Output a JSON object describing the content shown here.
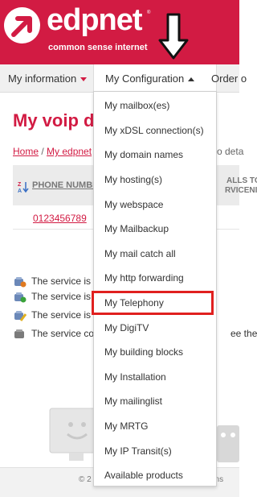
{
  "brand": {
    "name": "edpnet",
    "trademark": "®",
    "tagline": "common sense internet",
    "brand_color": "#d21b43"
  },
  "nav": {
    "my_information": "My information",
    "my_configuration": "My Configuration",
    "order": "Order o"
  },
  "dropdown": {
    "items": [
      "My mailbox(es)",
      "My xDSL connection(s)",
      "My domain names",
      "My hosting(s)",
      "My webspace",
      "My Mailbackup",
      "My mail catch all",
      "My http forwarding",
      "My Telephony",
      "My DigiTV",
      "My building blocks",
      "My Installation",
      "My mailinglist",
      "My MRTG",
      "My IP Transit(s)",
      "Available products"
    ],
    "highlighted_item": "My Telephony",
    "highlight_color": "#e0201f"
  },
  "page": {
    "title": "My voip d",
    "breadcrumb_home": "Home",
    "breadcrumb_sep": " / ",
    "breadcrumb_second": "My edpnet",
    "breadcrumb_tail": "o deta"
  },
  "table": {
    "header_phone": "PHONE NUMBE",
    "header_calls_line1": "ALLS TO",
    "header_calls_line2": "RVICENI",
    "rows": [
      {
        "phone": "0123456789"
      }
    ]
  },
  "legend": [
    {
      "text": "The service is",
      "tail": ""
    },
    {
      "text": "The service is",
      "tail": ""
    },
    {
      "text": "The service is",
      "tail": ""
    },
    {
      "text": "The service co",
      "tail": "ee the"
    }
  ],
  "footer": {
    "left": "© 2",
    "right": "ons"
  }
}
